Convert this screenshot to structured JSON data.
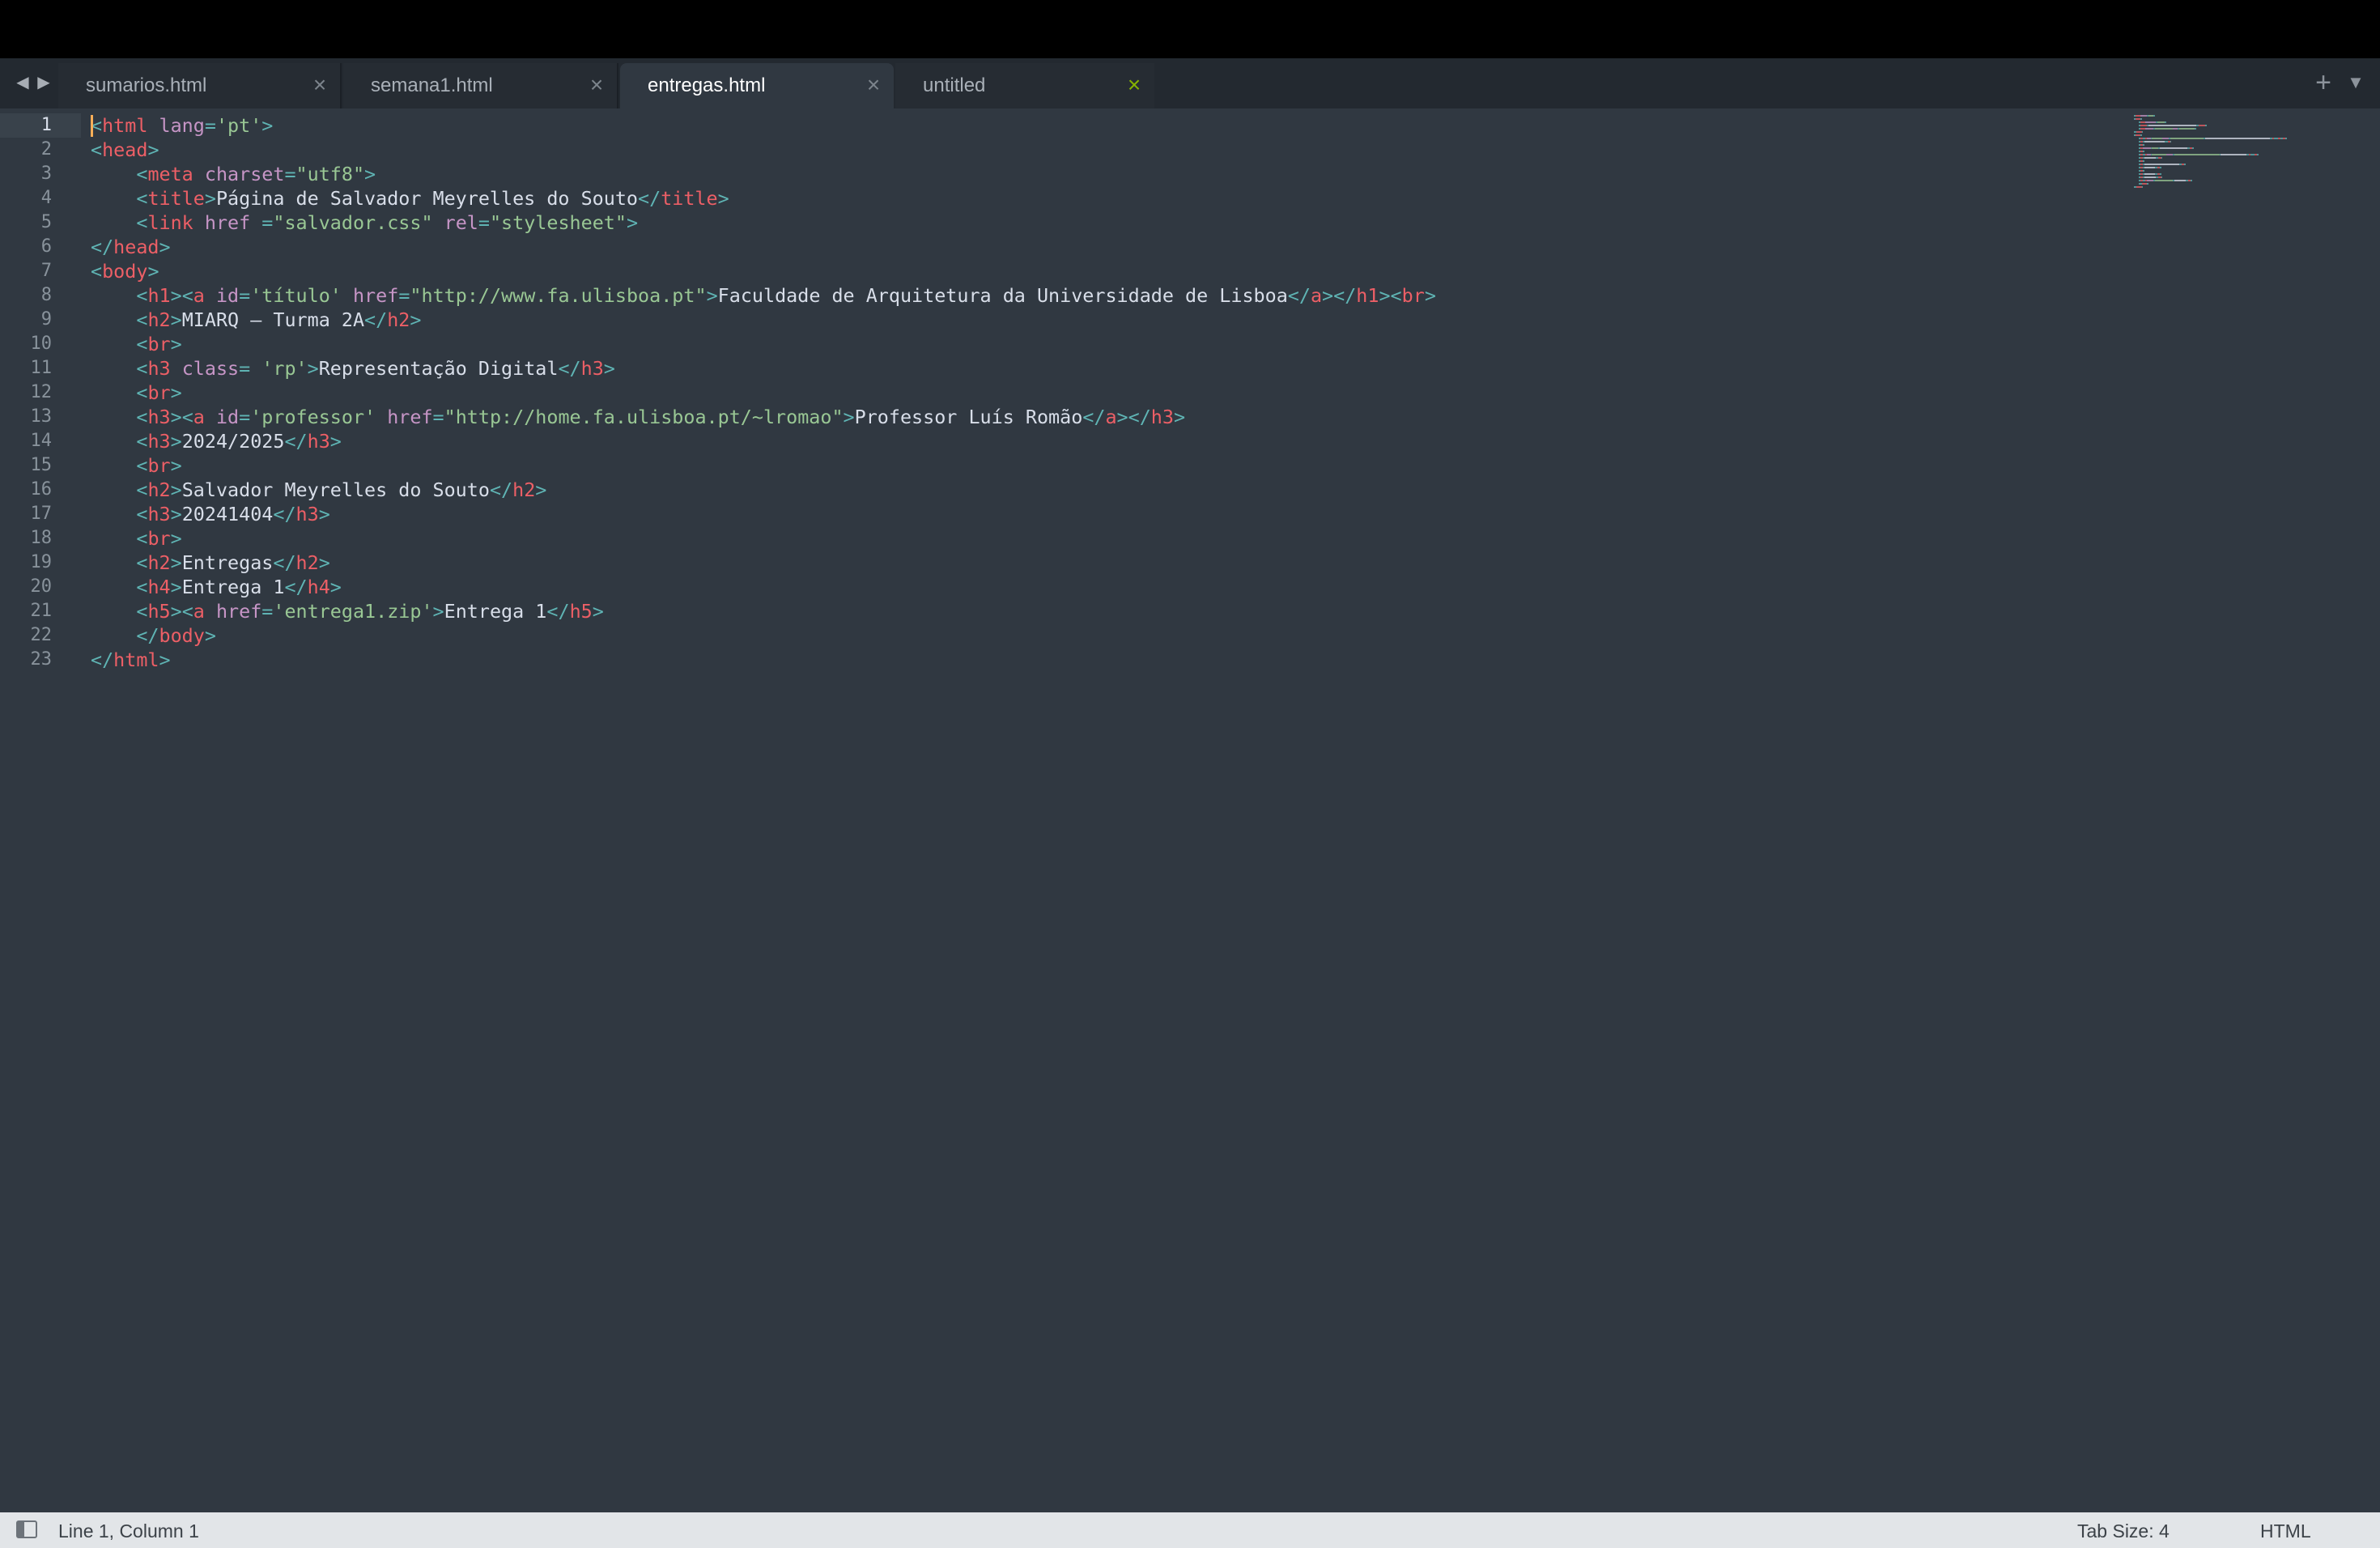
{
  "tabs": [
    {
      "label": "sumarios.html",
      "active": false,
      "dirty": false
    },
    {
      "label": "semana1.html",
      "active": false,
      "dirty": false
    },
    {
      "label": "entregas.html",
      "active": true,
      "dirty": false
    },
    {
      "label": "untitled",
      "active": false,
      "dirty": true
    }
  ],
  "nav": {
    "back_icon": "triangle-left",
    "forward_icon": "triangle-right",
    "new_tab_icon": "plus",
    "tab_menu_icon": "triangle-down"
  },
  "editor": {
    "active_line": 1,
    "line_numbers": [
      "1",
      "2",
      "3",
      "4",
      "5",
      "6",
      "7",
      "8",
      "9",
      "10",
      "11",
      "12",
      "13",
      "14",
      "15",
      "16",
      "17",
      "18",
      "19",
      "20",
      "21",
      "22",
      "23"
    ],
    "lines": [
      [
        [
          "p",
          "<"
        ],
        [
          "t",
          "html"
        ],
        [
          "a",
          " lang"
        ],
        [
          "p",
          "="
        ],
        [
          "s",
          "'pt'"
        ],
        [
          "p",
          ">"
        ]
      ],
      [
        [
          "p",
          "<"
        ],
        [
          "t",
          "head"
        ],
        [
          "p",
          ">"
        ]
      ],
      [
        [
          "x",
          "    "
        ],
        [
          "p",
          "<"
        ],
        [
          "t",
          "meta"
        ],
        [
          "a",
          " charset"
        ],
        [
          "p",
          "="
        ],
        [
          "s",
          "\"utf8\""
        ],
        [
          "p",
          ">"
        ]
      ],
      [
        [
          "x",
          "    "
        ],
        [
          "p",
          "<"
        ],
        [
          "t",
          "title"
        ],
        [
          "p",
          ">"
        ],
        [
          "x",
          "Página de Salvador Meyrelles do Souto"
        ],
        [
          "p",
          "</"
        ],
        [
          "t",
          "title"
        ],
        [
          "p",
          ">"
        ]
      ],
      [
        [
          "x",
          "    "
        ],
        [
          "p",
          "<"
        ],
        [
          "t",
          "link"
        ],
        [
          "a",
          " href "
        ],
        [
          "p",
          "="
        ],
        [
          "s",
          "\"salvador.css\""
        ],
        [
          "a",
          " rel"
        ],
        [
          "p",
          "="
        ],
        [
          "s",
          "\"stylesheet\""
        ],
        [
          "p",
          ">"
        ]
      ],
      [
        [
          "p",
          "</"
        ],
        [
          "t",
          "head"
        ],
        [
          "p",
          ">"
        ]
      ],
      [
        [
          "p",
          "<"
        ],
        [
          "t",
          "body"
        ],
        [
          "p",
          ">"
        ]
      ],
      [
        [
          "x",
          "    "
        ],
        [
          "p",
          "<"
        ],
        [
          "t",
          "h1"
        ],
        [
          "p",
          "><"
        ],
        [
          "t",
          "a"
        ],
        [
          "a",
          " id"
        ],
        [
          "p",
          "="
        ],
        [
          "s",
          "'título'"
        ],
        [
          "a",
          " href"
        ],
        [
          "p",
          "="
        ],
        [
          "s",
          "\"http://www.fa.ulisboa.pt\""
        ],
        [
          "p",
          ">"
        ],
        [
          "x",
          "Faculdade de Arquitetura da Universidade de Lisboa"
        ],
        [
          "p",
          "</"
        ],
        [
          "t",
          "a"
        ],
        [
          "p",
          "></"
        ],
        [
          "t",
          "h1"
        ],
        [
          "p",
          "><"
        ],
        [
          "t",
          "br"
        ],
        [
          "p",
          ">"
        ]
      ],
      [
        [
          "x",
          "    "
        ],
        [
          "p",
          "<"
        ],
        [
          "t",
          "h2"
        ],
        [
          "p",
          ">"
        ],
        [
          "x",
          "MIARQ – Turma 2A"
        ],
        [
          "p",
          "</"
        ],
        [
          "t",
          "h2"
        ],
        [
          "p",
          ">"
        ]
      ],
      [
        [
          "x",
          "    "
        ],
        [
          "p",
          "<"
        ],
        [
          "t",
          "br"
        ],
        [
          "p",
          ">"
        ]
      ],
      [
        [
          "x",
          "    "
        ],
        [
          "p",
          "<"
        ],
        [
          "t",
          "h3"
        ],
        [
          "a",
          " class"
        ],
        [
          "p",
          "="
        ],
        [
          "s",
          " 'rp'"
        ],
        [
          "p",
          ">"
        ],
        [
          "x",
          "Representação Digital"
        ],
        [
          "p",
          "</"
        ],
        [
          "t",
          "h3"
        ],
        [
          "p",
          ">"
        ]
      ],
      [
        [
          "x",
          "    "
        ],
        [
          "p",
          "<"
        ],
        [
          "t",
          "br"
        ],
        [
          "p",
          ">"
        ]
      ],
      [
        [
          "x",
          "    "
        ],
        [
          "p",
          "<"
        ],
        [
          "t",
          "h3"
        ],
        [
          "p",
          "><"
        ],
        [
          "t",
          "a"
        ],
        [
          "a",
          " id"
        ],
        [
          "p",
          "="
        ],
        [
          "s",
          "'professor'"
        ],
        [
          "a",
          " href"
        ],
        [
          "p",
          "="
        ],
        [
          "s",
          "\"http://home.fa.ulisboa.pt/~lromao\""
        ],
        [
          "p",
          ">"
        ],
        [
          "x",
          "Professor Luís Romão"
        ],
        [
          "p",
          "</"
        ],
        [
          "t",
          "a"
        ],
        [
          "p",
          "></"
        ],
        [
          "t",
          "h3"
        ],
        [
          "p",
          ">"
        ]
      ],
      [
        [
          "x",
          "    "
        ],
        [
          "p",
          "<"
        ],
        [
          "t",
          "h3"
        ],
        [
          "p",
          ">"
        ],
        [
          "x",
          "2024/2025"
        ],
        [
          "p",
          "</"
        ],
        [
          "t",
          "h3"
        ],
        [
          "p",
          ">"
        ]
      ],
      [
        [
          "x",
          "    "
        ],
        [
          "p",
          "<"
        ],
        [
          "t",
          "br"
        ],
        [
          "p",
          ">"
        ]
      ],
      [
        [
          "x",
          "    "
        ],
        [
          "p",
          "<"
        ],
        [
          "t",
          "h2"
        ],
        [
          "p",
          ">"
        ],
        [
          "x",
          "Salvador Meyrelles do Souto"
        ],
        [
          "p",
          "</"
        ],
        [
          "t",
          "h2"
        ],
        [
          "p",
          ">"
        ]
      ],
      [
        [
          "x",
          "    "
        ],
        [
          "p",
          "<"
        ],
        [
          "t",
          "h3"
        ],
        [
          "p",
          ">"
        ],
        [
          "x",
          "20241404"
        ],
        [
          "p",
          "</"
        ],
        [
          "t",
          "h3"
        ],
        [
          "p",
          ">"
        ]
      ],
      [
        [
          "x",
          "    "
        ],
        [
          "p",
          "<"
        ],
        [
          "t",
          "br"
        ],
        [
          "p",
          ">"
        ]
      ],
      [
        [
          "x",
          "    "
        ],
        [
          "p",
          "<"
        ],
        [
          "t",
          "h2"
        ],
        [
          "p",
          ">"
        ],
        [
          "x",
          "Entregas"
        ],
        [
          "p",
          "</"
        ],
        [
          "t",
          "h2"
        ],
        [
          "p",
          ">"
        ]
      ],
      [
        [
          "x",
          "    "
        ],
        [
          "p",
          "<"
        ],
        [
          "t",
          "h4"
        ],
        [
          "p",
          ">"
        ],
        [
          "x",
          "Entrega 1"
        ],
        [
          "p",
          "</"
        ],
        [
          "t",
          "h4"
        ],
        [
          "p",
          ">"
        ]
      ],
      [
        [
          "x",
          "    "
        ],
        [
          "p",
          "<"
        ],
        [
          "t",
          "h5"
        ],
        [
          "p",
          "><"
        ],
        [
          "t",
          "a"
        ],
        [
          "a",
          " href"
        ],
        [
          "p",
          "="
        ],
        [
          "s",
          "'entrega1.zip'"
        ],
        [
          "p",
          ">"
        ],
        [
          "x",
          "Entrega 1"
        ],
        [
          "p",
          "</"
        ],
        [
          "t",
          "h5"
        ],
        [
          "p",
          ">"
        ]
      ],
      [
        [
          "x",
          "    "
        ],
        [
          "p",
          "</"
        ],
        [
          "t",
          "body"
        ],
        [
          "p",
          ">"
        ]
      ],
      [
        [
          "p",
          "</"
        ],
        [
          "t",
          "html"
        ],
        [
          "p",
          ">"
        ]
      ]
    ]
  },
  "status": {
    "position": "Line 1, Column 1",
    "tab_size": "Tab Size: 4",
    "syntax": "HTML"
  },
  "colors": {
    "tag": "#ec5f66",
    "punct": "#5fb4b4",
    "attr": "#c695c6",
    "string": "#99c794",
    "text": "#d8dee9",
    "background": "#303841",
    "caret": "#f9ae58"
  }
}
